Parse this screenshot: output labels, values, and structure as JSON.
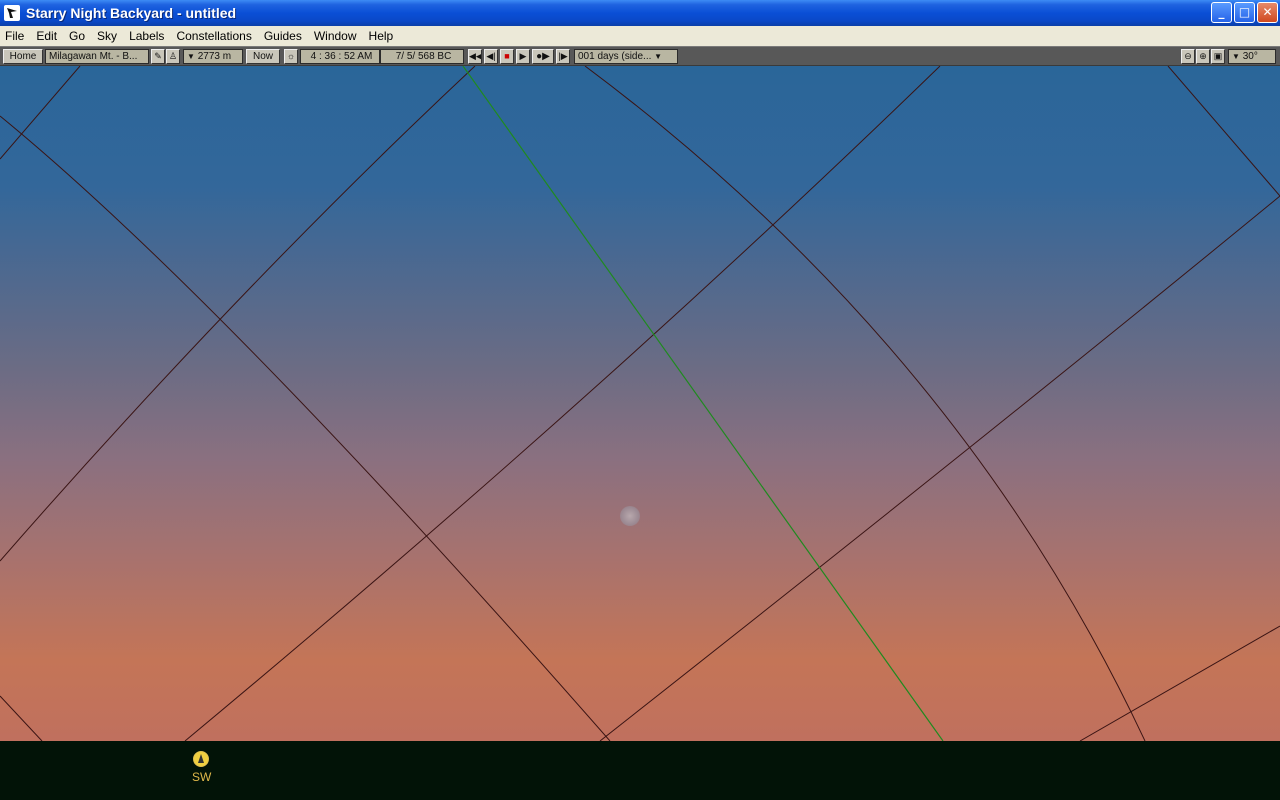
{
  "window": {
    "title": "Starry Night Backyard - untitled",
    "controls": {
      "minimize": "_",
      "maximize": "□",
      "close": "✕"
    }
  },
  "menu": [
    "File",
    "Edit",
    "Go",
    "Sky",
    "Labels",
    "Constellations",
    "Guides",
    "Window",
    "Help"
  ],
  "toolbar": {
    "home_label": "Home",
    "location": "Milagawan Mt. - B...",
    "elevation": "2773 m",
    "now_label": "Now",
    "time": "4 : 36 : 52 AM",
    "date": "7/   5/   568 BC",
    "time_step": "001 days (side...",
    "field_of_view": "30°"
  },
  "ground": {
    "compass_direction": "SW"
  },
  "colors": {
    "grid_line": "#3a1414",
    "ecliptic_line": "#1f8a1f",
    "ground": "#021307",
    "compass_label": "#e0b84a"
  }
}
